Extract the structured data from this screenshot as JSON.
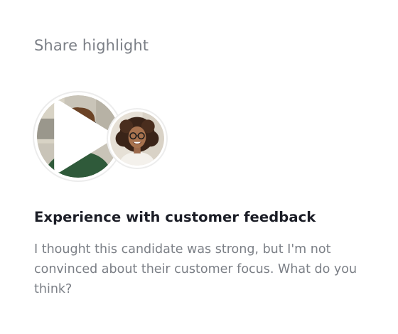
{
  "header": {
    "title": "Share highlight"
  },
  "highlight": {
    "title": "Experience with customer feedback",
    "comment": "I thought this candidate was strong, but I'm not convinced about their customer focus. What do you think?"
  },
  "icons": {
    "play": "play-icon"
  }
}
